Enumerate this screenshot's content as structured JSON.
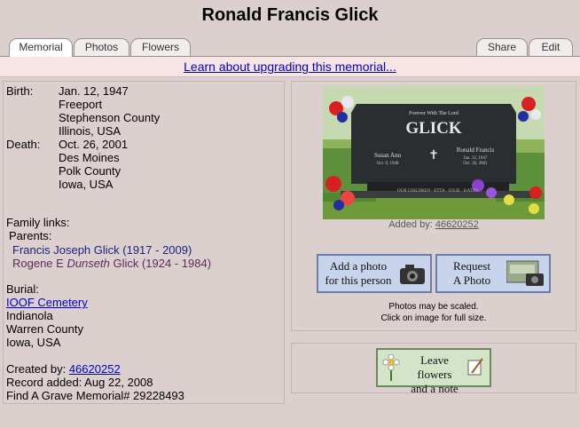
{
  "title": "Ronald Francis Glick",
  "tabs": {
    "memorial": "Memorial",
    "photos": "Photos",
    "flowers": "Flowers",
    "share": "Share",
    "edit": "Edit"
  },
  "upgrade_link": "Learn about upgrading this memorial...",
  "birth": {
    "label": "Birth:",
    "date": "Jan. 12, 1947",
    "city": "Freeport",
    "county": "Stephenson County",
    "state": "Illinois, USA"
  },
  "death": {
    "label": "Death:",
    "date": "Oct. 26, 2001",
    "city": "Des Moines",
    "county": "Polk County",
    "state": "Iowa, USA"
  },
  "family": {
    "label": "Family links:",
    "parents_label": "Parents:",
    "parent1": "Francis Joseph Glick (1917 - 2009)",
    "parent2_pre": "Rogene E ",
    "parent2_italic": "Dunseth",
    "parent2_post": " Glick (1924 - 1984)"
  },
  "burial": {
    "label": "Burial:",
    "cemetery": "IOOF Cemetery",
    "city": "Indianola",
    "county": "Warren County",
    "state": "Iowa, USA"
  },
  "created_by": {
    "label": "Created by:",
    "user": "46620252"
  },
  "record_added": "Record added: Aug 22, 2008",
  "memorial_id": "Find A Grave Memorial# 29228493",
  "photo": {
    "top_text": "Forever With The Lord",
    "stone_name": "GLICK",
    "left_name": "Susan Ann",
    "left_date": "Oct. 9, 1948",
    "right_name": "Ronald Francis",
    "right_date1": "Jan. 12, 1947",
    "right_date2": "Oct. 26, 2001",
    "bottom_text": "OUR CHILDREN · ETTA · JULIE · KATHY",
    "added_by_label": "Added by:",
    "added_by_user": "46620252"
  },
  "buttons": {
    "add_photo_1": "Add a photo",
    "add_photo_2": "for this person",
    "request_1": "Request",
    "request_2": "A Photo",
    "flowers_1": "Leave flowers",
    "flowers_2": "and a note"
  },
  "notes": {
    "scaled": "Photos may be scaled.",
    "click": "Click on image for full size."
  }
}
